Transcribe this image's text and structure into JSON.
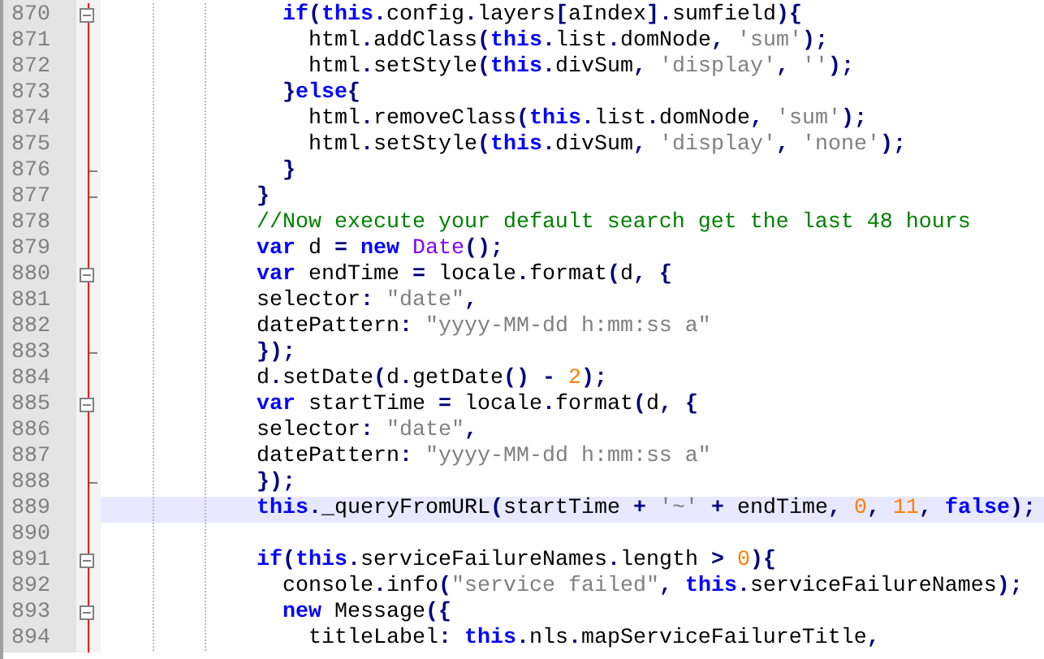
{
  "editor": {
    "lines": [
      {
        "number": "870",
        "fold_start": true,
        "fold_end": false,
        "current": false,
        "tokens": [
          {
            "kind": "keyword",
            "text": "              if"
          },
          {
            "kind": "op",
            "text": "("
          },
          {
            "kind": "keyword",
            "text": "this"
          },
          {
            "kind": "op",
            "text": "."
          },
          {
            "kind": "plain",
            "text": "config"
          },
          {
            "kind": "op",
            "text": "."
          },
          {
            "kind": "plain",
            "text": "layers"
          },
          {
            "kind": "op",
            "text": "["
          },
          {
            "kind": "plain",
            "text": "aIndex"
          },
          {
            "kind": "op",
            "text": "]."
          },
          {
            "kind": "plain",
            "text": "sumfield"
          },
          {
            "kind": "op",
            "text": "){"
          }
        ]
      },
      {
        "number": "871",
        "fold_start": false,
        "fold_end": false,
        "current": false,
        "tokens": [
          {
            "kind": "plain",
            "text": "                html"
          },
          {
            "kind": "op",
            "text": "."
          },
          {
            "kind": "plain",
            "text": "addClass"
          },
          {
            "kind": "op",
            "text": "("
          },
          {
            "kind": "keyword",
            "text": "this"
          },
          {
            "kind": "op",
            "text": "."
          },
          {
            "kind": "plain",
            "text": "list"
          },
          {
            "kind": "op",
            "text": "."
          },
          {
            "kind": "plain",
            "text": "domNode"
          },
          {
            "kind": "op",
            "text": ", "
          },
          {
            "kind": "string",
            "text": "'sum'"
          },
          {
            "kind": "op",
            "text": ");"
          }
        ]
      },
      {
        "number": "872",
        "fold_start": false,
        "fold_end": false,
        "current": false,
        "tokens": [
          {
            "kind": "plain",
            "text": "                html"
          },
          {
            "kind": "op",
            "text": "."
          },
          {
            "kind": "plain",
            "text": "setStyle"
          },
          {
            "kind": "op",
            "text": "("
          },
          {
            "kind": "keyword",
            "text": "this"
          },
          {
            "kind": "op",
            "text": "."
          },
          {
            "kind": "plain",
            "text": "divSum"
          },
          {
            "kind": "op",
            "text": ", "
          },
          {
            "kind": "string",
            "text": "'display'"
          },
          {
            "kind": "op",
            "text": ", "
          },
          {
            "kind": "string",
            "text": "''"
          },
          {
            "kind": "op",
            "text": ");"
          }
        ]
      },
      {
        "number": "873",
        "fold_start": false,
        "fold_end": false,
        "current": false,
        "tokens": [
          {
            "kind": "op",
            "text": "              }"
          },
          {
            "kind": "keyword",
            "text": "else"
          },
          {
            "kind": "op",
            "text": "{"
          }
        ]
      },
      {
        "number": "874",
        "fold_start": false,
        "fold_end": false,
        "current": false,
        "tokens": [
          {
            "kind": "plain",
            "text": "                html"
          },
          {
            "kind": "op",
            "text": "."
          },
          {
            "kind": "plain",
            "text": "removeClass"
          },
          {
            "kind": "op",
            "text": "("
          },
          {
            "kind": "keyword",
            "text": "this"
          },
          {
            "kind": "op",
            "text": "."
          },
          {
            "kind": "plain",
            "text": "list"
          },
          {
            "kind": "op",
            "text": "."
          },
          {
            "kind": "plain",
            "text": "domNode"
          },
          {
            "kind": "op",
            "text": ", "
          },
          {
            "kind": "string",
            "text": "'sum'"
          },
          {
            "kind": "op",
            "text": ");"
          }
        ]
      },
      {
        "number": "875",
        "fold_start": false,
        "fold_end": false,
        "current": false,
        "tokens": [
          {
            "kind": "plain",
            "text": "                html"
          },
          {
            "kind": "op",
            "text": "."
          },
          {
            "kind": "plain",
            "text": "setStyle"
          },
          {
            "kind": "op",
            "text": "("
          },
          {
            "kind": "keyword",
            "text": "this"
          },
          {
            "kind": "op",
            "text": "."
          },
          {
            "kind": "plain",
            "text": "divSum"
          },
          {
            "kind": "op",
            "text": ", "
          },
          {
            "kind": "string",
            "text": "'display'"
          },
          {
            "kind": "op",
            "text": ", "
          },
          {
            "kind": "string",
            "text": "'none'"
          },
          {
            "kind": "op",
            "text": ");"
          }
        ]
      },
      {
        "number": "876",
        "fold_start": false,
        "fold_end": true,
        "current": false,
        "tokens": [
          {
            "kind": "op",
            "text": "              }"
          }
        ]
      },
      {
        "number": "877",
        "fold_start": false,
        "fold_end": true,
        "current": false,
        "tokens": [
          {
            "kind": "op",
            "text": "            }"
          }
        ]
      },
      {
        "number": "878",
        "fold_start": false,
        "fold_end": false,
        "current": false,
        "tokens": [
          {
            "kind": "comment",
            "text": "            //Now execute your default search get the last 48 hours"
          }
        ]
      },
      {
        "number": "879",
        "fold_start": false,
        "fold_end": false,
        "current": false,
        "tokens": [
          {
            "kind": "keyword",
            "text": "            var"
          },
          {
            "kind": "plain",
            "text": " d "
          },
          {
            "kind": "op",
            "text": "= "
          },
          {
            "kind": "keyword",
            "text": "new "
          },
          {
            "kind": "type",
            "text": "Date"
          },
          {
            "kind": "op",
            "text": "();"
          }
        ]
      },
      {
        "number": "880",
        "fold_start": true,
        "fold_end": false,
        "current": false,
        "tokens": [
          {
            "kind": "keyword",
            "text": "            var"
          },
          {
            "kind": "plain",
            "text": " endTime "
          },
          {
            "kind": "op",
            "text": "="
          },
          {
            "kind": "plain",
            "text": " locale"
          },
          {
            "kind": "op",
            "text": "."
          },
          {
            "kind": "plain",
            "text": "format"
          },
          {
            "kind": "op",
            "text": "("
          },
          {
            "kind": "plain",
            "text": "d"
          },
          {
            "kind": "op",
            "text": ", {"
          }
        ]
      },
      {
        "number": "881",
        "fold_start": false,
        "fold_end": false,
        "current": false,
        "tokens": [
          {
            "kind": "plain",
            "text": "            selector"
          },
          {
            "kind": "op",
            "text": ": "
          },
          {
            "kind": "string",
            "text": "\"date\""
          },
          {
            "kind": "op",
            "text": ","
          }
        ]
      },
      {
        "number": "882",
        "fold_start": false,
        "fold_end": false,
        "current": false,
        "tokens": [
          {
            "kind": "plain",
            "text": "            datePattern"
          },
          {
            "kind": "op",
            "text": ": "
          },
          {
            "kind": "string",
            "text": "\"yyyy-MM-dd h:mm:ss a\""
          }
        ]
      },
      {
        "number": "883",
        "fold_start": false,
        "fold_end": true,
        "current": false,
        "tokens": [
          {
            "kind": "op",
            "text": "            });"
          }
        ]
      },
      {
        "number": "884",
        "fold_start": false,
        "fold_end": false,
        "current": false,
        "tokens": [
          {
            "kind": "plain",
            "text": "            d"
          },
          {
            "kind": "op",
            "text": "."
          },
          {
            "kind": "plain",
            "text": "setDate"
          },
          {
            "kind": "op",
            "text": "("
          },
          {
            "kind": "plain",
            "text": "d"
          },
          {
            "kind": "op",
            "text": "."
          },
          {
            "kind": "plain",
            "text": "getDate"
          },
          {
            "kind": "op",
            "text": "() - "
          },
          {
            "kind": "number",
            "text": "2"
          },
          {
            "kind": "op",
            "text": ");"
          }
        ]
      },
      {
        "number": "885",
        "fold_start": true,
        "fold_end": false,
        "current": false,
        "tokens": [
          {
            "kind": "keyword",
            "text": "            var"
          },
          {
            "kind": "plain",
            "text": " startTime "
          },
          {
            "kind": "op",
            "text": "="
          },
          {
            "kind": "plain",
            "text": " locale"
          },
          {
            "kind": "op",
            "text": "."
          },
          {
            "kind": "plain",
            "text": "format"
          },
          {
            "kind": "op",
            "text": "("
          },
          {
            "kind": "plain",
            "text": "d"
          },
          {
            "kind": "op",
            "text": ", {"
          }
        ]
      },
      {
        "number": "886",
        "fold_start": false,
        "fold_end": false,
        "current": false,
        "tokens": [
          {
            "kind": "plain",
            "text": "            selector"
          },
          {
            "kind": "op",
            "text": ": "
          },
          {
            "kind": "string",
            "text": "\"date\""
          },
          {
            "kind": "op",
            "text": ","
          }
        ]
      },
      {
        "number": "887",
        "fold_start": false,
        "fold_end": false,
        "current": false,
        "tokens": [
          {
            "kind": "plain",
            "text": "            datePattern"
          },
          {
            "kind": "op",
            "text": ": "
          },
          {
            "kind": "string",
            "text": "\"yyyy-MM-dd h:mm:ss a\""
          }
        ]
      },
      {
        "number": "888",
        "fold_start": false,
        "fold_end": true,
        "current": false,
        "tokens": [
          {
            "kind": "op",
            "text": "            });"
          }
        ]
      },
      {
        "number": "889",
        "fold_start": false,
        "fold_end": false,
        "current": true,
        "tokens": [
          {
            "kind": "keyword",
            "text": "            this"
          },
          {
            "kind": "op",
            "text": "."
          },
          {
            "kind": "plain",
            "text": "_queryFromURL"
          },
          {
            "kind": "op",
            "text": "("
          },
          {
            "kind": "plain",
            "text": "startTime "
          },
          {
            "kind": "op",
            "text": "+ "
          },
          {
            "kind": "string",
            "text": "'~'"
          },
          {
            "kind": "op",
            "text": " + "
          },
          {
            "kind": "plain",
            "text": "endTime"
          },
          {
            "kind": "op",
            "text": ", "
          },
          {
            "kind": "number",
            "text": "0"
          },
          {
            "kind": "op",
            "text": ", "
          },
          {
            "kind": "number",
            "text": "11"
          },
          {
            "kind": "op",
            "text": ", "
          },
          {
            "kind": "keyword",
            "text": "false"
          },
          {
            "kind": "op",
            "text": ");"
          }
        ]
      },
      {
        "number": "890",
        "fold_start": false,
        "fold_end": false,
        "current": false
      },
      {
        "number": "891",
        "fold_start": true,
        "fold_end": false,
        "current": false,
        "tokens": [
          {
            "kind": "keyword",
            "text": "            if"
          },
          {
            "kind": "op",
            "text": "("
          },
          {
            "kind": "keyword",
            "text": "this"
          },
          {
            "kind": "op",
            "text": "."
          },
          {
            "kind": "plain",
            "text": "serviceFailureNames"
          },
          {
            "kind": "op",
            "text": "."
          },
          {
            "kind": "plain",
            "text": "length "
          },
          {
            "kind": "op",
            "text": "> "
          },
          {
            "kind": "number",
            "text": "0"
          },
          {
            "kind": "op",
            "text": "){"
          }
        ]
      },
      {
        "number": "892",
        "fold_start": false,
        "fold_end": false,
        "current": false,
        "tokens": [
          {
            "kind": "plain",
            "text": "              console"
          },
          {
            "kind": "op",
            "text": "."
          },
          {
            "kind": "plain",
            "text": "info"
          },
          {
            "kind": "op",
            "text": "("
          },
          {
            "kind": "string",
            "text": "\"service failed\""
          },
          {
            "kind": "op",
            "text": ", "
          },
          {
            "kind": "keyword",
            "text": "this"
          },
          {
            "kind": "op",
            "text": "."
          },
          {
            "kind": "plain",
            "text": "serviceFailureNames"
          },
          {
            "kind": "op",
            "text": ");"
          }
        ]
      },
      {
        "number": "893",
        "fold_start": true,
        "fold_end": false,
        "current": false,
        "tokens": [
          {
            "kind": "keyword",
            "text": "              new"
          },
          {
            "kind": "plain",
            "text": " Message"
          },
          {
            "kind": "op",
            "text": "({"
          }
        ]
      },
      {
        "number": "894",
        "fold_start": false,
        "fold_end": false,
        "current": false,
        "tokens": [
          {
            "kind": "plain",
            "text": "                titleLabel"
          },
          {
            "kind": "op",
            "text": ": "
          },
          {
            "kind": "keyword",
            "text": "this"
          },
          {
            "kind": "op",
            "text": "."
          },
          {
            "kind": "plain",
            "text": "nls"
          },
          {
            "kind": "op",
            "text": "."
          },
          {
            "kind": "plain",
            "text": "mapServiceFailureTitle"
          },
          {
            "kind": "op",
            "text": ","
          }
        ]
      }
    ]
  }
}
